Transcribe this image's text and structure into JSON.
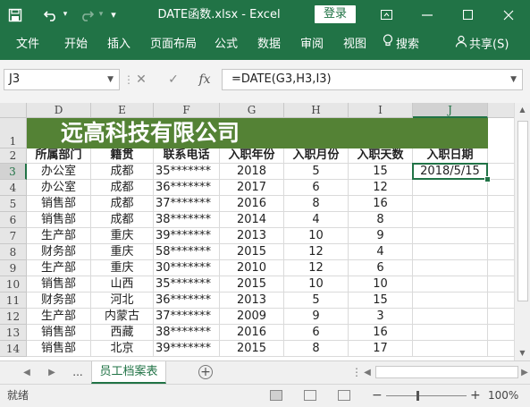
{
  "window": {
    "title": "DATE函数.xlsx  -  Excel",
    "login": "登录",
    "quick_access": {
      "save": "save-icon",
      "undo": "undo-icon",
      "redo": "redo-icon",
      "customize": "▾"
    },
    "controls": [
      "ribbon-display-icon",
      "minimize-icon",
      "maximize-icon",
      "close-icon"
    ]
  },
  "ribbon": {
    "tabs": [
      "文件",
      "开始",
      "插入",
      "页面布局",
      "公式",
      "数据",
      "审阅",
      "视图"
    ],
    "search": "搜索",
    "share": "共享(S)"
  },
  "formula_bar": {
    "name_box": "J3",
    "formula": "=DATE(G3,H3,I3)",
    "fx": "fx"
  },
  "sheet": {
    "columns": [
      "D",
      "E",
      "F",
      "G",
      "H",
      "I",
      "J"
    ],
    "selected_column": "J",
    "row_numbers": [
      "1",
      "2",
      "3",
      "4",
      "5",
      "6",
      "7",
      "8",
      "9",
      "10",
      "11",
      "12",
      "13",
      "14"
    ],
    "selected_row": "3",
    "banner": "远高科技有限公司",
    "headers": [
      "所属部门",
      "籍贯",
      "联系电话",
      "入职年份",
      "入职月份",
      "入职天数",
      "入职日期"
    ],
    "rows": [
      [
        "办公室",
        "成都",
        "35*******",
        "2018",
        "5",
        "15",
        "2018/5/15"
      ],
      [
        "办公室",
        "成都",
        "36*******",
        "2017",
        "6",
        "12",
        ""
      ],
      [
        "销售部",
        "成都",
        "37*******",
        "2016",
        "8",
        "16",
        ""
      ],
      [
        "销售部",
        "成都",
        "38*******",
        "2014",
        "4",
        "8",
        ""
      ],
      [
        "生产部",
        "重庆",
        "39*******",
        "2013",
        "10",
        "9",
        ""
      ],
      [
        "财务部",
        "重庆",
        "58*******",
        "2015",
        "12",
        "4",
        ""
      ],
      [
        "生产部",
        "重庆",
        "30*******",
        "2010",
        "12",
        "6",
        ""
      ],
      [
        "销售部",
        "山西",
        "35*******",
        "2015",
        "10",
        "10",
        ""
      ],
      [
        "财务部",
        "河北",
        "36*******",
        "2013",
        "5",
        "15",
        ""
      ],
      [
        "生产部",
        "内蒙古",
        "37*******",
        "2009",
        "9",
        "3",
        ""
      ],
      [
        "销售部",
        "西藏",
        "38*******",
        "2016",
        "6",
        "16",
        ""
      ],
      [
        "销售部",
        "北京",
        "39*******",
        "2015",
        "8",
        "17",
        ""
      ]
    ]
  },
  "sheet_tabs": {
    "ellipsis": "...",
    "active": "员工档案表",
    "add": "+"
  },
  "status": {
    "ready": "就绪",
    "zoom": "100%",
    "minus": "−",
    "plus": "+"
  },
  "colors": {
    "excel_green": "#217346",
    "banner_green": "#548235"
  }
}
